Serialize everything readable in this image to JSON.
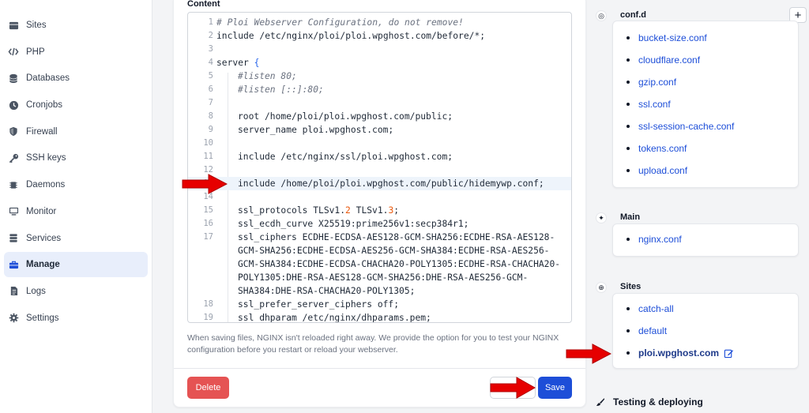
{
  "sidebar": {
    "items": [
      {
        "label": "Sites",
        "icon": "table-icon"
      },
      {
        "label": "PHP",
        "icon": "code-icon"
      },
      {
        "label": "Databases",
        "icon": "database-icon"
      },
      {
        "label": "Cronjobs",
        "icon": "clock-icon"
      },
      {
        "label": "Firewall",
        "icon": "shield-icon"
      },
      {
        "label": "SSH keys",
        "icon": "key-icon"
      },
      {
        "label": "Daemons",
        "icon": "chip-icon"
      },
      {
        "label": "Monitor",
        "icon": "monitor-icon"
      },
      {
        "label": "Services",
        "icon": "server-icon"
      },
      {
        "label": "Manage",
        "icon": "briefcase-icon",
        "active": true
      },
      {
        "label": "Logs",
        "icon": "document-icon"
      },
      {
        "label": "Settings",
        "icon": "gear-icon"
      }
    ]
  },
  "editor": {
    "label": "Content",
    "lines": [
      {
        "n": "1",
        "text": "# Ploi Webserver Configuration, do not remove!"
      },
      {
        "n": "2",
        "text": "include /etc/nginx/ploi/ploi.wpghost.com/before/*;"
      },
      {
        "n": "3",
        "text": ""
      },
      {
        "n": "4",
        "text": "server "
      },
      {
        "n": "5",
        "text": "#listen 80;"
      },
      {
        "n": "6",
        "text": "#listen [::]:80;"
      },
      {
        "n": "7",
        "text": ""
      },
      {
        "n": "8",
        "text": "root /home/ploi/ploi.wpghost.com/public;"
      },
      {
        "n": "9",
        "text": "server_name ploi.wpghost.com;"
      },
      {
        "n": "10",
        "text": ""
      },
      {
        "n": "11",
        "text": "include /etc/nginx/ssl/ploi.wpghost.com;"
      },
      {
        "n": "12",
        "text": ""
      },
      {
        "n": "13",
        "text": "include /home/ploi/ploi.wpghost.com/public/hidemywp.conf;"
      },
      {
        "n": "14",
        "text": ""
      },
      {
        "n": "15",
        "text": "ssl_protocols TLSv1."
      },
      {
        "n": "16",
        "text": "ssl_ecdh_curve X25519:prime256v1:secp384r1;"
      },
      {
        "n": "17",
        "text": "ssl_ciphers ECDHE-ECDSA-AES128-GCM-SHA256:ECDHE-RSA-AES128-"
      },
      {
        "n": "",
        "text": "GCM-SHA256:ECDHE-ECDSA-AES256-GCM-SHA384:ECDHE-RSA-AES256-"
      },
      {
        "n": "",
        "text": "GCM-SHA384:ECDHE-ECDSA-CHACHA20-POLY1305:ECDHE-RSA-CHACHA20-"
      },
      {
        "n": "",
        "text": "POLY1305:DHE-RSA-AES128-GCM-SHA256:DHE-RSA-AES256-GCM-"
      },
      {
        "n": "",
        "text": "SHA384:DHE-RSA-CHACHA20-POLY1305;"
      },
      {
        "n": "18",
        "text": "ssl_prefer_server_ciphers off;"
      },
      {
        "n": "19",
        "text": "ssl_dhparam /etc/nginx/dhparams.pem;"
      }
    ],
    "brace": "{",
    "tls_v2": "2",
    "tls_mid": " TLSv1.",
    "tls_v3": "3",
    "tls_end": ";"
  },
  "help_text": "When saving files, NGINX isn't reloaded right away. We provide the option for you to test your NGINX configuration before you restart or reload your webserver.",
  "buttons": {
    "delete": "Delete",
    "save": "Save"
  },
  "confd": {
    "title": "conf.d",
    "plus": "+",
    "items": [
      "bucket-size.conf",
      "cloudflare.conf",
      "gzip.conf",
      "ssl.conf",
      "ssl-session-cache.conf",
      "tokens.conf",
      "upload.conf"
    ]
  },
  "main_section": {
    "title": "Main",
    "items": [
      "nginx.conf"
    ]
  },
  "sites_section": {
    "title": "Sites",
    "items": [
      "catch-all",
      "default",
      "ploi.wpghost.com"
    ]
  },
  "testing": {
    "title": "Testing & deploying"
  },
  "colors": {
    "accent": "#1d4ed8",
    "danger": "#e55353",
    "arrow": "#e60000"
  }
}
